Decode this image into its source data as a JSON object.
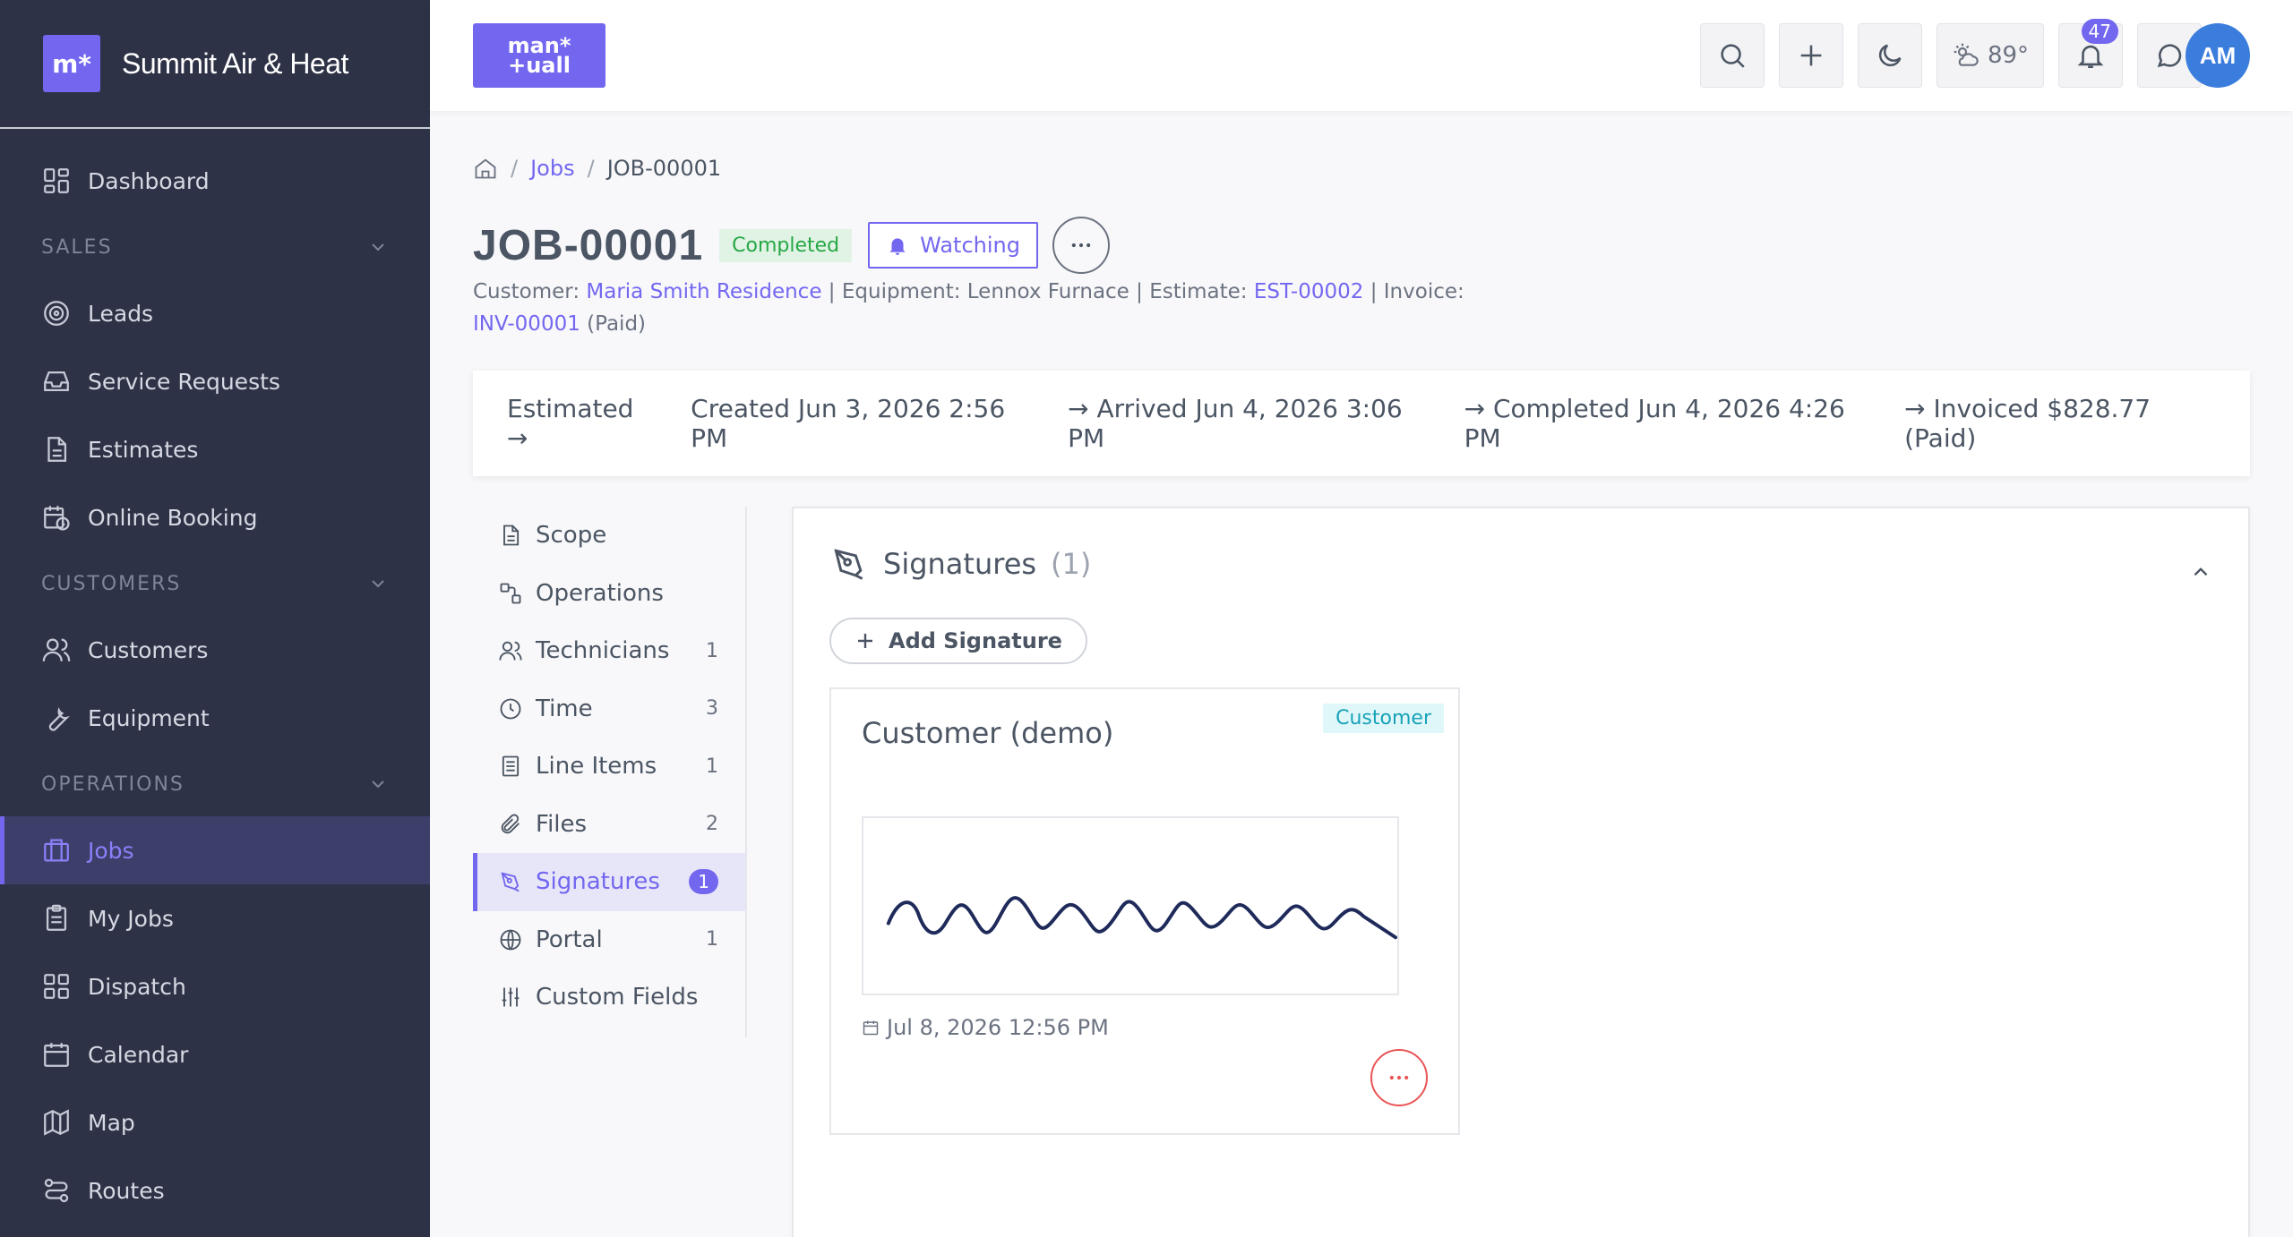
{
  "brand": {
    "logo_text": "m*",
    "name": "Summit Air & Heat"
  },
  "sidebar": {
    "items": [
      {
        "label": "Dashboard",
        "icon": "dashboard-icon"
      },
      {
        "section": "SALES"
      },
      {
        "label": "Leads",
        "icon": "target-icon"
      },
      {
        "label": "Service Requests",
        "icon": "inbox-icon"
      },
      {
        "label": "Estimates",
        "icon": "document-icon"
      },
      {
        "label": "Online Booking",
        "icon": "calendar-clock-icon"
      },
      {
        "section": "CUSTOMERS"
      },
      {
        "label": "Customers",
        "icon": "users-icon"
      },
      {
        "label": "Equipment",
        "icon": "wrench-icon"
      },
      {
        "section": "OPERATIONS"
      },
      {
        "label": "Jobs",
        "icon": "briefcase-icon",
        "active": true
      },
      {
        "label": "My Jobs",
        "icon": "clipboard-icon"
      },
      {
        "label": "Dispatch",
        "icon": "grid-icon"
      },
      {
        "label": "Calendar",
        "icon": "calendar-icon"
      },
      {
        "label": "Map",
        "icon": "map-icon"
      },
      {
        "label": "Routes",
        "icon": "route-icon"
      }
    ],
    "labels": {
      "dashboard": "Dashboard",
      "sales": "SALES",
      "leads": "Leads",
      "service_requests": "Service Requests",
      "estimates": "Estimates",
      "online_booking": "Online Booking",
      "customers_section": "CUSTOMERS",
      "customers": "Customers",
      "equipment": "Equipment",
      "operations": "OPERATIONS",
      "jobs": "Jobs",
      "my_jobs": "My Jobs",
      "dispatch": "Dispatch",
      "calendar": "Calendar",
      "map": "Map",
      "routes": "Routes"
    }
  },
  "topbar": {
    "app_logo_line1": "man*",
    "app_logo_line2": "+uall",
    "weather_temp": "89°",
    "notifications_count": "47",
    "avatar_initials": "AM",
    "accent_color": "#7367f0"
  },
  "breadcrumb": {
    "jobs": "Jobs",
    "current": "JOB-00001"
  },
  "job": {
    "title": "JOB-00001",
    "status": "Completed",
    "watch_label": "Watching",
    "customer_label": "Customer:",
    "customer": "Maria Smith Residence",
    "equipment_text": "| Equipment: Lennox Furnace | Estimate:",
    "estimate": "EST-00002",
    "invoice_label": "| Invoice:",
    "invoice": "INV-00001",
    "invoice_status": "(Paid)"
  },
  "timeline": {
    "estimated": "Estimated →",
    "created": "Created Jun 3, 2026 2:56 PM",
    "arrived": "→ Arrived Jun 4, 2026 3:06 PM",
    "completed": "→ Completed Jun 4, 2026 4:26 PM",
    "invoiced": "→ Invoiced $828.77 (Paid)"
  },
  "subnav": {
    "scope": {
      "label": "Scope",
      "count": ""
    },
    "operations": {
      "label": "Operations",
      "count": ""
    },
    "technicians": {
      "label": "Technicians",
      "count": "1"
    },
    "time": {
      "label": "Time",
      "count": "3"
    },
    "line_items": {
      "label": "Line Items",
      "count": "1"
    },
    "files": {
      "label": "Files",
      "count": "2"
    },
    "signatures": {
      "label": "Signatures",
      "count": "1"
    },
    "portal": {
      "label": "Portal",
      "count": "1"
    },
    "custom_fields": {
      "label": "Custom Fields",
      "count": ""
    }
  },
  "signatures": {
    "title": "Signatures",
    "count": "(1)",
    "add_label": "Add Signature",
    "card": {
      "name": "Customer (demo)",
      "tag": "Customer",
      "date": "Jul 8, 2026 12:56 PM"
    }
  }
}
